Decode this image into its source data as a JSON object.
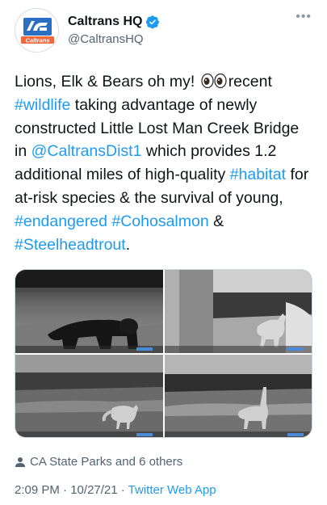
{
  "author": {
    "display_name": "Caltrans HQ",
    "handle": "@CaltransHQ",
    "logo_text": "Caltrans",
    "verified": true,
    "brand_color": "#1d9bf0",
    "logo_orange": "#f2673a",
    "logo_blue": "#2b6fc4"
  },
  "more_icon": "•••",
  "tweet": {
    "t1": "Lions, Elk & Bears oh my! ",
    "t2": "recent",
    "hashtag_wildlife": "#wildlife",
    "t3": " taking advantage of newly constructed Little Lost Man Creek Bridge in ",
    "mention": "@CaltransDist1",
    "t4": " which provides 1.2 additional miles of high-quality ",
    "hashtag_habitat": "#habitat",
    "t5": " for at-risk species & the survival of young, ",
    "hashtag_endangered": "#endangered",
    "t6": " ",
    "hashtag_coho": "#Cohosalmon",
    "t7": " & ",
    "hashtag_steelhead": "#Steelheadtrout",
    "t8": "."
  },
  "media": [
    {
      "subject": "bear-under-bridge"
    },
    {
      "subject": "mountain-lion-under-bridge"
    },
    {
      "subject": "fox-under-bridge"
    },
    {
      "subject": "elk-under-bridge"
    }
  ],
  "liked_by": "CA State Parks and 6 others",
  "meta": {
    "time": "2:09 PM",
    "separator": " · ",
    "date": "10/27/21",
    "source": "Twitter Web App"
  }
}
